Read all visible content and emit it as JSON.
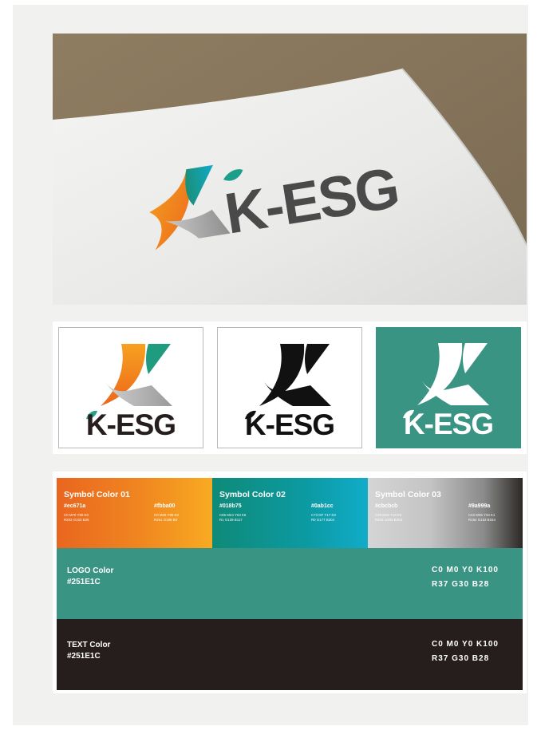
{
  "brand": {
    "name": "K-ESG"
  },
  "colors": {
    "orange": "#ec671a",
    "yellow": "#fbba00",
    "green": "#018b75",
    "cyan": "#0ab1cc",
    "gray_light": "#cbcbcb",
    "gray": "#9a999a",
    "logo_teal": "#3a9483",
    "text_dark": "#251E1C"
  },
  "symbol_colors": [
    {
      "title": "Symbol Color 01",
      "start_hex": "#ec671a",
      "start_values": [
        "C0 M70 Y90 K0",
        "R203 G103 B26"
      ],
      "end_hex": "#fbba00",
      "end_values": [
        "C0 M30 Y95 K0",
        "R251 G186 B0"
      ]
    },
    {
      "title": "Symbol Color 02",
      "start_hex": "#018b75",
      "start_values": [
        "C85 M24 Y63 K6",
        "R1 G139 B117"
      ],
      "end_hex": "#0ab1cc",
      "end_values": [
        "C73 M7 Y17 K0",
        "R0 G177 B204"
      ]
    },
    {
      "title": "Symbol Color 03",
      "start_hex": "#cbcbcb",
      "start_values": [
        "C20 M15 Y16 K0",
        "R203 G203 B203"
      ],
      "end_hex": "#9a999a",
      "end_values": [
        "C42 M35 Y34 K1",
        "R154 G153 B154"
      ]
    }
  ],
  "logo_color": {
    "label": "LOGO Color",
    "hex": "#251E1C",
    "cmyk": "C0 M0 Y0 K100",
    "rgb": "R37 G30 B28"
  },
  "text_color": {
    "label": "TEXT Color",
    "hex": "#251E1C",
    "cmyk": "C0 M0 Y0 K100",
    "rgb": "R37 G30 B28"
  }
}
